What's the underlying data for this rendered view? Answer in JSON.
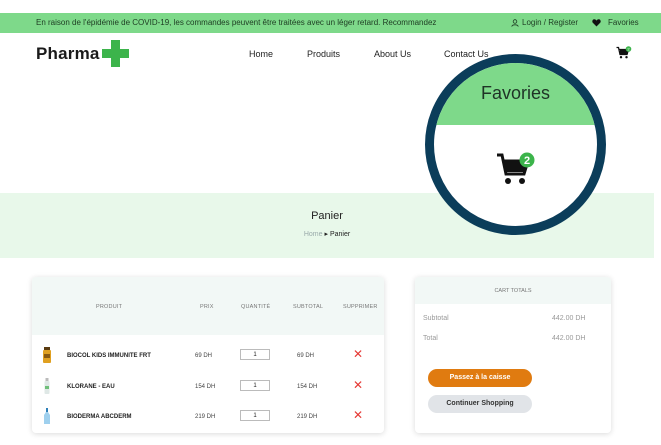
{
  "topbar": {
    "message": "En raison de l'épidémie de COVID-19, les commandes peuvent être traitées avec un léger retard. Recommandez",
    "login": "Login / Register",
    "favorites": "Favories"
  },
  "header": {
    "logo": "Pharma",
    "nav": [
      "Home",
      "Produits",
      "About Us",
      "Contact Us"
    ],
    "cart_count": "2"
  },
  "magnifier": {
    "title": "Favories",
    "cart_count": "2"
  },
  "hero": {
    "title": "Panier",
    "breadcrumb_home": "Home",
    "breadcrumb_current": "Panier"
  },
  "cart": {
    "columns": [
      "PRODUIT",
      "PRIX",
      "QUANTITÉ",
      "SUBTOTAL",
      "SUPPRIMER"
    ],
    "rows": [
      {
        "name": "BIOCOL KIDS IMMUNITE FRT",
        "price": "69 DH",
        "quantity": "1",
        "subtotal": "69 DH"
      },
      {
        "name": "KLORANE - EAU",
        "price": "154 DH",
        "quantity": "1",
        "subtotal": "154 DH"
      },
      {
        "name": "BIODERMA ABCDERM",
        "price": "219 DH",
        "quantity": "1",
        "subtotal": "219 DH"
      }
    ]
  },
  "totals": {
    "title": "CART TOTALS",
    "subtotal_label": "Subtotal",
    "subtotal_value": "442.00 DH",
    "total_label": "Total",
    "total_value": "442.00 DH",
    "checkout_label": "Passez à la caisse",
    "continue_label": "Continuer Shopping"
  },
  "colors": {
    "topbar": "#7ed98a",
    "hero": "#e8f8ea",
    "magnifier_ring": "#0b3d5a",
    "checkout": "#e07b10",
    "delete": "#e53935",
    "badge": "#3cb44b"
  }
}
